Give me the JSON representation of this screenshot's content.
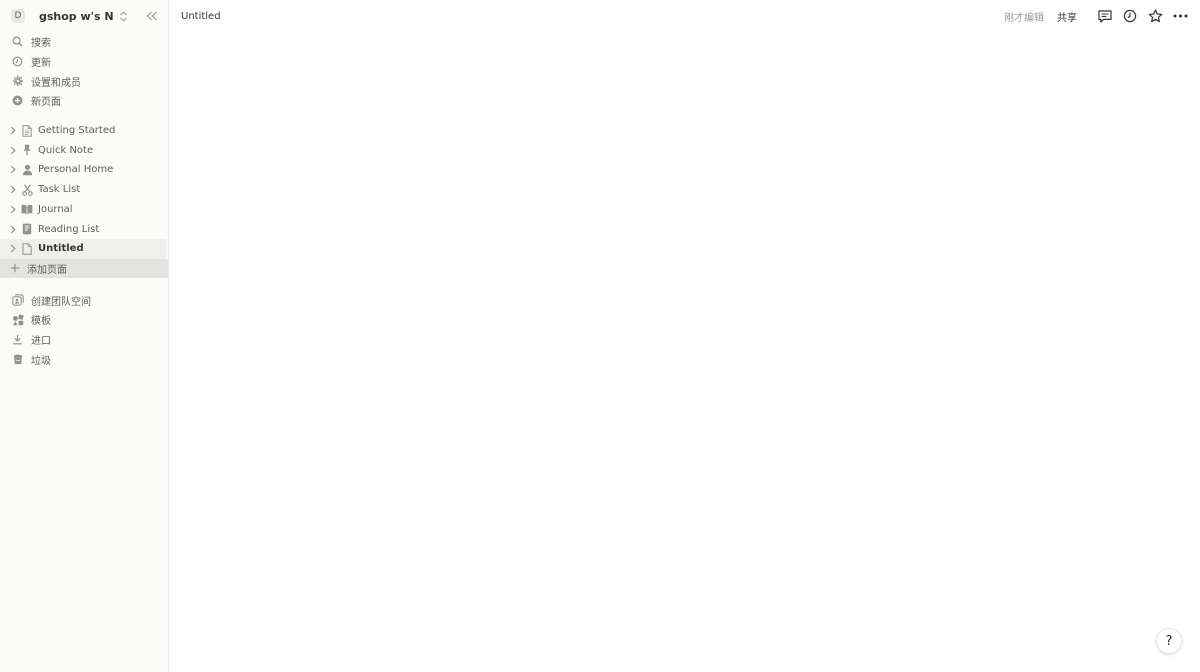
{
  "workspace": {
    "avatar_letter": "D",
    "name": "gshop w's Not..."
  },
  "menu": [
    {
      "label": "搜索",
      "icon": "search-icon"
    },
    {
      "label": "更新",
      "icon": "clock-icon"
    },
    {
      "label": "设置和成员",
      "icon": "gear-icon"
    },
    {
      "label": "新页面",
      "icon": "plus-circle-icon"
    }
  ],
  "pages": [
    {
      "label": "Getting Started",
      "icon": "document-icon"
    },
    {
      "label": "Quick Note",
      "icon": "pin-icon"
    },
    {
      "label": "Personal Home",
      "icon": "person-icon"
    },
    {
      "label": "Task List",
      "icon": "scissors-icon"
    },
    {
      "label": "Journal",
      "icon": "book-icon"
    },
    {
      "label": "Reading List",
      "icon": "notebook-icon"
    },
    {
      "label": "Untitled",
      "icon": "document-icon",
      "active": true
    }
  ],
  "add_page_label": "添加页面",
  "bottom_menu": [
    {
      "label": "创建团队空间",
      "icon": "team-icon"
    },
    {
      "label": "模板",
      "icon": "shapes-icon"
    },
    {
      "label": "进口",
      "icon": "download-icon"
    },
    {
      "label": "垃圾",
      "icon": "trash-icon"
    }
  ],
  "topbar": {
    "breadcrumb": "Untitled",
    "edited": "刚才编辑",
    "share": "共享"
  },
  "help_label": "?",
  "colors": {
    "sidebar_bg": "#fbfbfa",
    "active_row": "#efefee",
    "hover_row": "#e3e3e1",
    "text": "#37352f",
    "muted": "#9b9a97"
  }
}
